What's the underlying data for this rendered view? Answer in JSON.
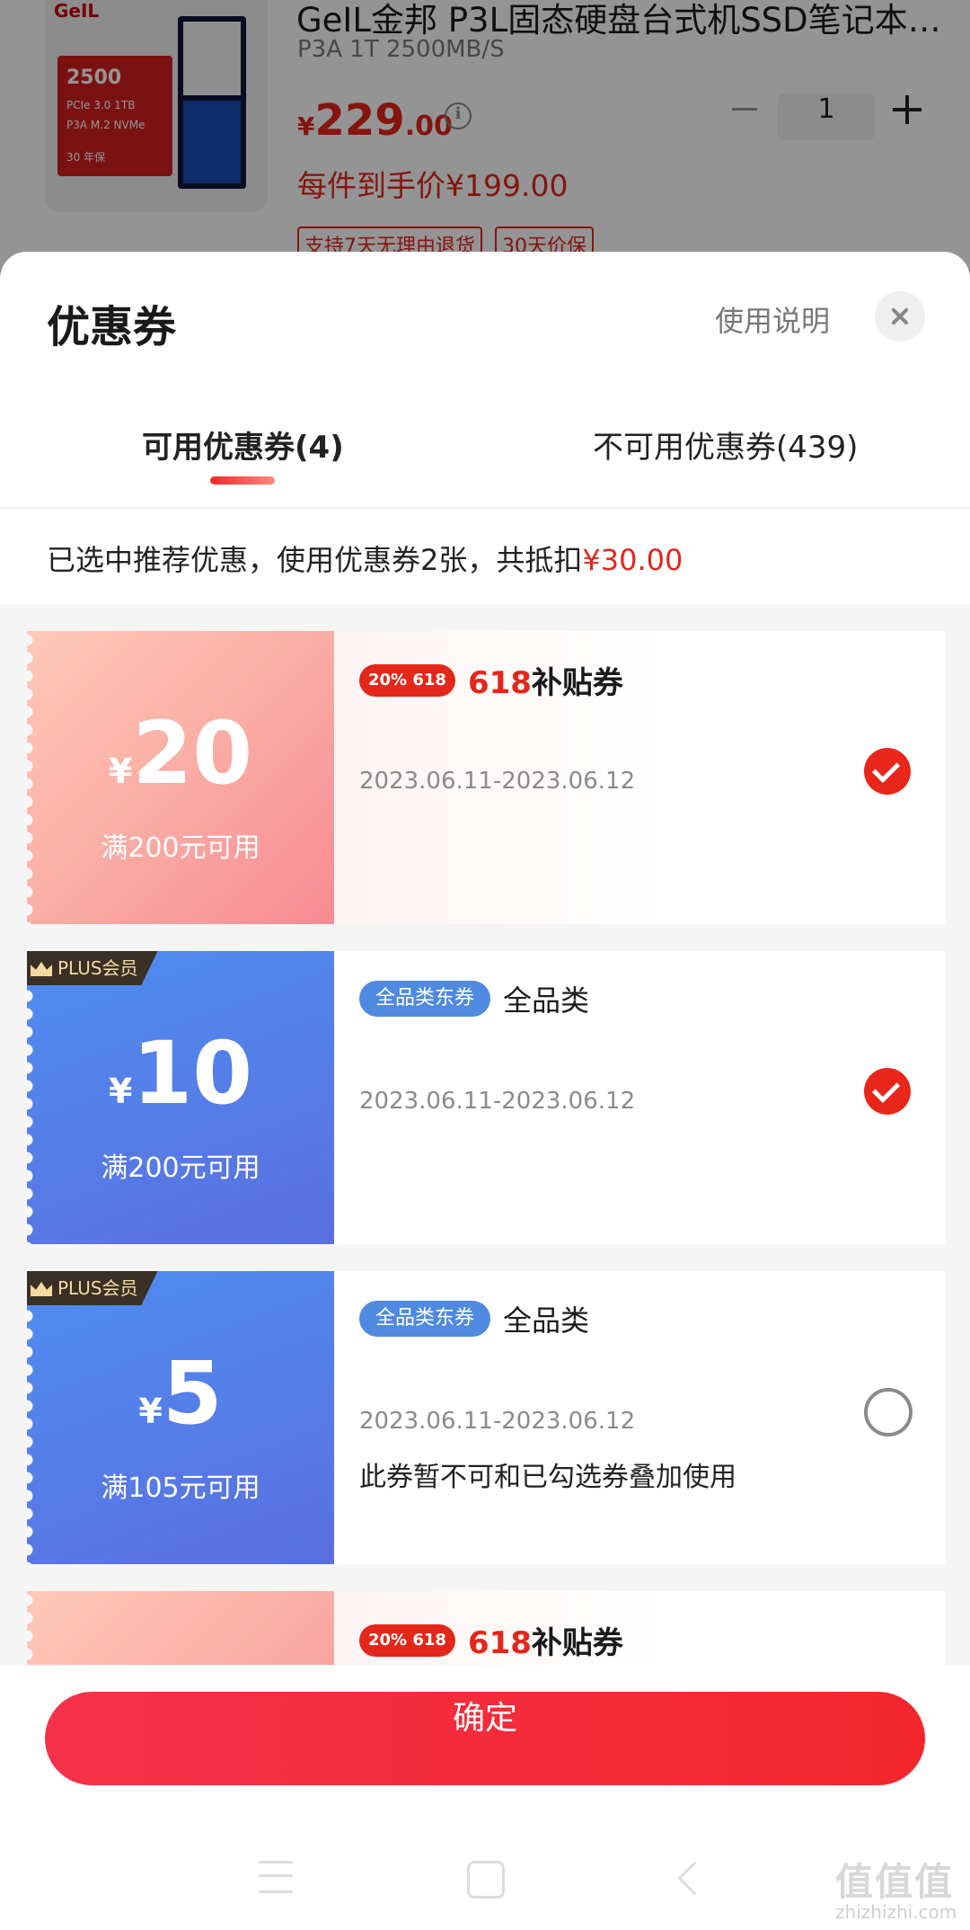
{
  "product": {
    "brand": "GeIL",
    "image_box_big": "2500",
    "image_box_line1": "PCIe 3.0  1TB",
    "image_box_line2": "P3A M.2 NVMe",
    "image_box_line3": "30 年保",
    "title": "GeIL金邦 P3L固态硬盘台式机SSD笔记本…",
    "spec": "P3A 1T 2500MB/S",
    "price_currency": "¥",
    "price_int": "229",
    "price_dec": ".00",
    "final_price": "每件到手价¥199.00",
    "quantity": "1",
    "tags": [
      "支持7天无理由退货",
      "30天价保"
    ]
  },
  "sheet": {
    "title": "优惠券",
    "usage_link": "使用说明",
    "tabs": [
      {
        "label": "可用优惠券(4)"
      },
      {
        "label": "不可用优惠券(439)"
      }
    ],
    "summary_prefix": "已选中推荐优惠，使用优惠券2张，共抵扣",
    "summary_amount": "¥30.00"
  },
  "coupons": [
    {
      "amount": "20",
      "currency": "¥",
      "condition": "满200元可用",
      "pill": "20% 618",
      "title_red": "618",
      "title": "补贴券",
      "date": "2023.06.11-2023.06.12",
      "checked": true
    },
    {
      "amount": "10",
      "currency": "¥",
      "condition": "满200元可用",
      "badge": "PLUS会员",
      "pill": "全品类东券",
      "title": "全品类",
      "date": "2023.06.11-2023.06.12",
      "checked": true
    },
    {
      "amount": "5",
      "currency": "¥",
      "condition": "满105元可用",
      "badge": "PLUS会员",
      "pill": "全品类东券",
      "title": "全品类",
      "date": "2023.06.11-2023.06.12",
      "note": "此券暂不可和已勾选券叠加使用",
      "checked": false
    },
    {
      "pill": "20% 618",
      "title_red": "618",
      "title": "补贴券"
    }
  ],
  "confirm_label": "确定",
  "watermark": "值值值",
  "watermark_sub": "zhizhizhi.com",
  "colors": {
    "accent": "#e3271b",
    "plus_blue": "#4f8ae0"
  }
}
